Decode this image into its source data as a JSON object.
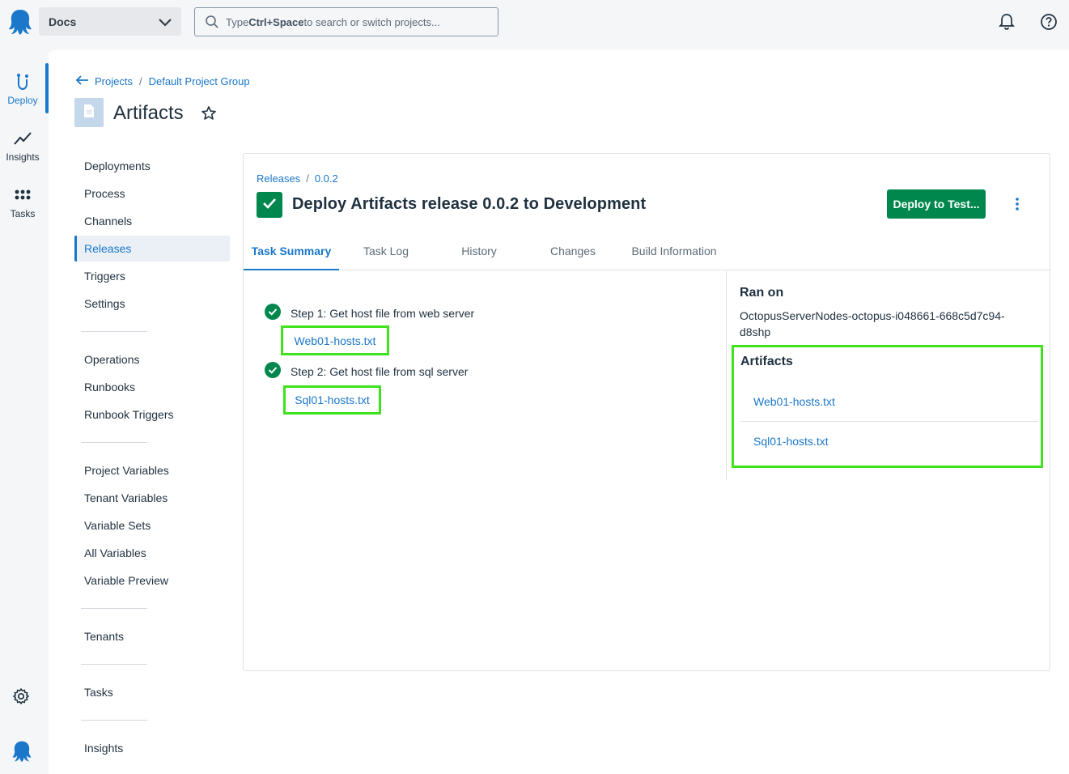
{
  "topbar": {
    "space_name": "Docs",
    "search_placeholder_prefix": "Type ",
    "search_placeholder_shortcut": "Ctrl+Space",
    "search_placeholder_suffix": " to search or switch projects..."
  },
  "rail": {
    "items": [
      {
        "label": "Deploy"
      },
      {
        "label": "Insights"
      },
      {
        "label": "Tasks"
      }
    ]
  },
  "breadcrumb": {
    "projects": "Projects",
    "sep": "/",
    "group": "Default Project Group"
  },
  "project": {
    "title": "Artifacts"
  },
  "project_nav": {
    "items": [
      {
        "label": "Deployments"
      },
      {
        "label": "Process"
      },
      {
        "label": "Channels"
      },
      {
        "label": "Releases"
      },
      {
        "label": "Triggers"
      },
      {
        "label": "Settings"
      },
      {
        "label": "Operations"
      },
      {
        "label": "Runbooks"
      },
      {
        "label": "Runbook Triggers"
      },
      {
        "label": "Project Variables"
      },
      {
        "label": "Tenant Variables"
      },
      {
        "label": "Variable Sets"
      },
      {
        "label": "All Variables"
      },
      {
        "label": "Variable Preview"
      },
      {
        "label": "Tenants"
      },
      {
        "label": "Tasks"
      },
      {
        "label": "Insights"
      }
    ],
    "active": "Releases"
  },
  "release": {
    "breadcrumb_releases": "Releases",
    "breadcrumb_sep": "/",
    "breadcrumb_version": "0.0.2",
    "title": "Deploy Artifacts release 0.0.2 to Development",
    "deploy_button": "Deploy to Test...",
    "tabs": [
      {
        "label": "Task Summary"
      },
      {
        "label": "Task Log"
      },
      {
        "label": "History"
      },
      {
        "label": "Changes"
      },
      {
        "label": "Build Information"
      }
    ],
    "active_tab": "Task Summary",
    "steps": [
      {
        "label": "Step 1: Get host file from web server",
        "artifact": "Web01-hosts.txt"
      },
      {
        "label": "Step 2: Get host file from sql server",
        "artifact": "Sql01-hosts.txt"
      }
    ],
    "ran_on_heading": "Ran on",
    "ran_on_value": "OctopusServerNodes-octopus-i048661-668c5d7c94-d8shp",
    "artifacts_heading": "Artifacts",
    "artifacts": [
      "Web01-hosts.txt",
      "Sql01-hosts.txt"
    ]
  },
  "colors": {
    "accent": "#1a77ca",
    "success": "#00874d",
    "highlight": "#3fe21c"
  }
}
